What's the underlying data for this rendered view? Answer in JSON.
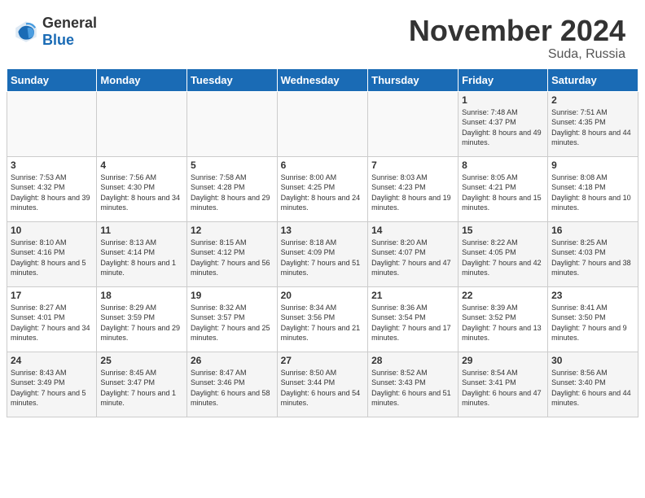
{
  "header": {
    "logo_general": "General",
    "logo_blue": "Blue",
    "month_title": "November 2024",
    "location": "Suda, Russia"
  },
  "days_of_week": [
    "Sunday",
    "Monday",
    "Tuesday",
    "Wednesday",
    "Thursday",
    "Friday",
    "Saturday"
  ],
  "weeks": [
    [
      {
        "day": "",
        "info": ""
      },
      {
        "day": "",
        "info": ""
      },
      {
        "day": "",
        "info": ""
      },
      {
        "day": "",
        "info": ""
      },
      {
        "day": "",
        "info": ""
      },
      {
        "day": "1",
        "info": "Sunrise: 7:48 AM\nSunset: 4:37 PM\nDaylight: 8 hours and 49 minutes."
      },
      {
        "day": "2",
        "info": "Sunrise: 7:51 AM\nSunset: 4:35 PM\nDaylight: 8 hours and 44 minutes."
      }
    ],
    [
      {
        "day": "3",
        "info": "Sunrise: 7:53 AM\nSunset: 4:32 PM\nDaylight: 8 hours and 39 minutes."
      },
      {
        "day": "4",
        "info": "Sunrise: 7:56 AM\nSunset: 4:30 PM\nDaylight: 8 hours and 34 minutes."
      },
      {
        "day": "5",
        "info": "Sunrise: 7:58 AM\nSunset: 4:28 PM\nDaylight: 8 hours and 29 minutes."
      },
      {
        "day": "6",
        "info": "Sunrise: 8:00 AM\nSunset: 4:25 PM\nDaylight: 8 hours and 24 minutes."
      },
      {
        "day": "7",
        "info": "Sunrise: 8:03 AM\nSunset: 4:23 PM\nDaylight: 8 hours and 19 minutes."
      },
      {
        "day": "8",
        "info": "Sunrise: 8:05 AM\nSunset: 4:21 PM\nDaylight: 8 hours and 15 minutes."
      },
      {
        "day": "9",
        "info": "Sunrise: 8:08 AM\nSunset: 4:18 PM\nDaylight: 8 hours and 10 minutes."
      }
    ],
    [
      {
        "day": "10",
        "info": "Sunrise: 8:10 AM\nSunset: 4:16 PM\nDaylight: 8 hours and 5 minutes."
      },
      {
        "day": "11",
        "info": "Sunrise: 8:13 AM\nSunset: 4:14 PM\nDaylight: 8 hours and 1 minute."
      },
      {
        "day": "12",
        "info": "Sunrise: 8:15 AM\nSunset: 4:12 PM\nDaylight: 7 hours and 56 minutes."
      },
      {
        "day": "13",
        "info": "Sunrise: 8:18 AM\nSunset: 4:09 PM\nDaylight: 7 hours and 51 minutes."
      },
      {
        "day": "14",
        "info": "Sunrise: 8:20 AM\nSunset: 4:07 PM\nDaylight: 7 hours and 47 minutes."
      },
      {
        "day": "15",
        "info": "Sunrise: 8:22 AM\nSunset: 4:05 PM\nDaylight: 7 hours and 42 minutes."
      },
      {
        "day": "16",
        "info": "Sunrise: 8:25 AM\nSunset: 4:03 PM\nDaylight: 7 hours and 38 minutes."
      }
    ],
    [
      {
        "day": "17",
        "info": "Sunrise: 8:27 AM\nSunset: 4:01 PM\nDaylight: 7 hours and 34 minutes."
      },
      {
        "day": "18",
        "info": "Sunrise: 8:29 AM\nSunset: 3:59 PM\nDaylight: 7 hours and 29 minutes."
      },
      {
        "day": "19",
        "info": "Sunrise: 8:32 AM\nSunset: 3:57 PM\nDaylight: 7 hours and 25 minutes."
      },
      {
        "day": "20",
        "info": "Sunrise: 8:34 AM\nSunset: 3:56 PM\nDaylight: 7 hours and 21 minutes."
      },
      {
        "day": "21",
        "info": "Sunrise: 8:36 AM\nSunset: 3:54 PM\nDaylight: 7 hours and 17 minutes."
      },
      {
        "day": "22",
        "info": "Sunrise: 8:39 AM\nSunset: 3:52 PM\nDaylight: 7 hours and 13 minutes."
      },
      {
        "day": "23",
        "info": "Sunrise: 8:41 AM\nSunset: 3:50 PM\nDaylight: 7 hours and 9 minutes."
      }
    ],
    [
      {
        "day": "24",
        "info": "Sunrise: 8:43 AM\nSunset: 3:49 PM\nDaylight: 7 hours and 5 minutes."
      },
      {
        "day": "25",
        "info": "Sunrise: 8:45 AM\nSunset: 3:47 PM\nDaylight: 7 hours and 1 minute."
      },
      {
        "day": "26",
        "info": "Sunrise: 8:47 AM\nSunset: 3:46 PM\nDaylight: 6 hours and 58 minutes."
      },
      {
        "day": "27",
        "info": "Sunrise: 8:50 AM\nSunset: 3:44 PM\nDaylight: 6 hours and 54 minutes."
      },
      {
        "day": "28",
        "info": "Sunrise: 8:52 AM\nSunset: 3:43 PM\nDaylight: 6 hours and 51 minutes."
      },
      {
        "day": "29",
        "info": "Sunrise: 8:54 AM\nSunset: 3:41 PM\nDaylight: 6 hours and 47 minutes."
      },
      {
        "day": "30",
        "info": "Sunrise: 8:56 AM\nSunset: 3:40 PM\nDaylight: 6 hours and 44 minutes."
      }
    ]
  ]
}
